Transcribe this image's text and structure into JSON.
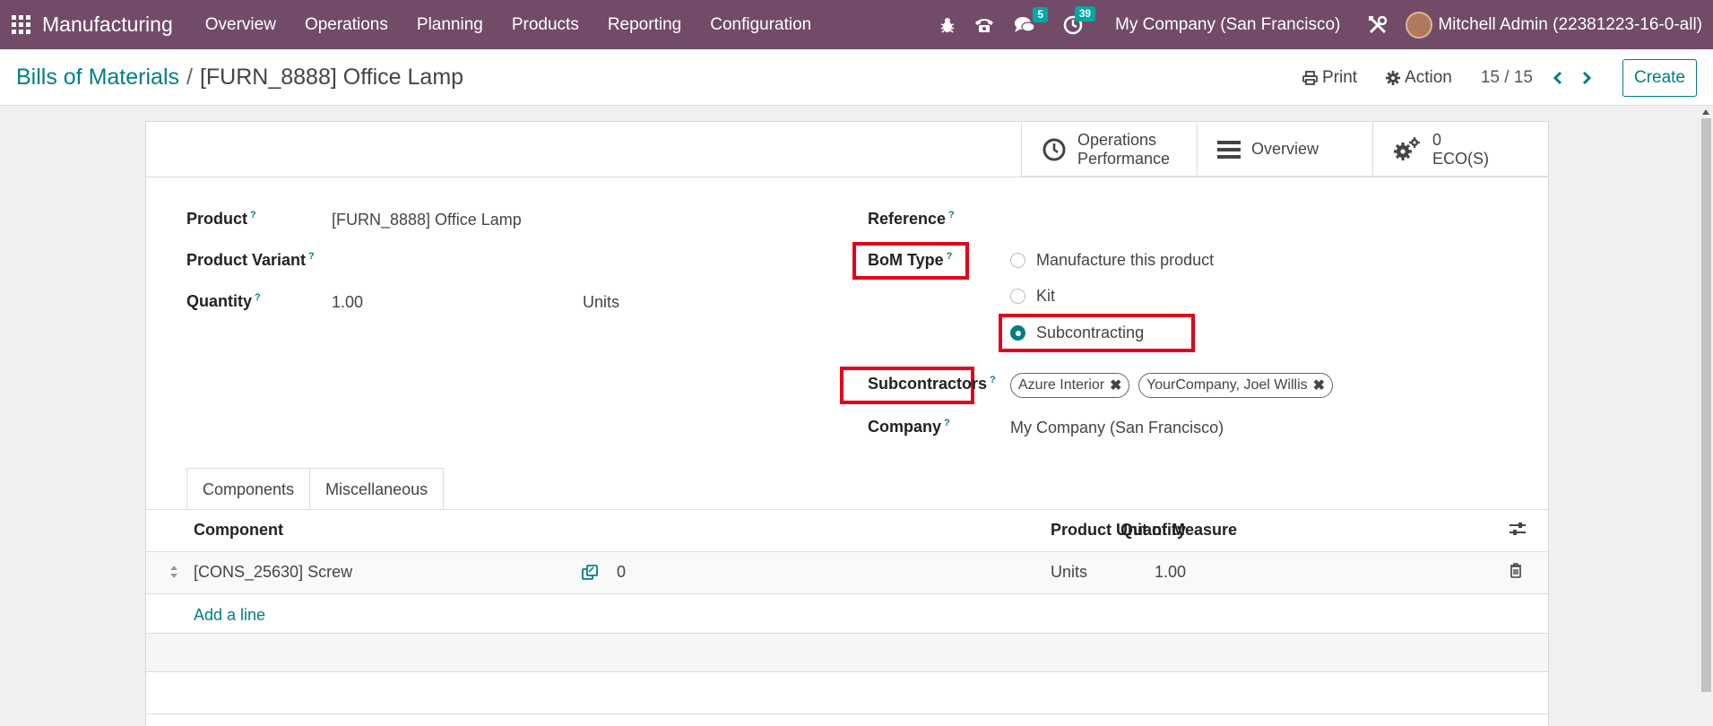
{
  "navbar": {
    "brand": "Manufacturing",
    "menu": [
      "Overview",
      "Operations",
      "Planning",
      "Products",
      "Reporting",
      "Configuration"
    ],
    "messages_count": "5",
    "activities_count": "39",
    "company": "My Company (San Francisco)",
    "user": "Mitchell Admin (22381223-16-0-all)"
  },
  "control_panel": {
    "breadcrumb_parent": "Bills of Materials",
    "breadcrumb_separator": "/",
    "breadcrumb_current": "[FURN_8888] Office Lamp",
    "print_label": "Print",
    "action_label": "Action",
    "pager": "15 / 15",
    "create_label": "Create"
  },
  "smart_buttons": {
    "operations_line1": "Operations",
    "operations_line2": "Performance",
    "overview": "Overview",
    "eco_count": "0",
    "eco_label": "ECO(S)"
  },
  "form": {
    "product_label": "Product",
    "product_value": "[FURN_8888] Office Lamp",
    "variant_label": "Product Variant",
    "quantity_label": "Quantity",
    "quantity_value": "1.00",
    "quantity_uom": "Units",
    "reference_label": "Reference",
    "bom_type_label": "BoM Type",
    "bom_type_options": [
      "Manufacture this product",
      "Kit",
      "Subcontracting"
    ],
    "bom_type_selected": "Subcontracting",
    "subcontractors_label": "Subcontractors",
    "subcontractors": [
      "Azure Interior",
      "YourCompany, Joel Willis"
    ],
    "company_label": "Company",
    "company_value": "My Company (San Francisco)",
    "help_mark": "?"
  },
  "tabs": [
    "Components",
    "Miscellaneous"
  ],
  "components_table": {
    "headers": {
      "component": "Component",
      "quantity": "Quantity",
      "uom": "Product Unit of Measure"
    },
    "rows": [
      {
        "component": "[CONS_25630] Screw",
        "forecast": "0",
        "quantity": "1.00",
        "uom": "Units"
      }
    ],
    "add_line": "Add a line"
  },
  "colors": {
    "navbar": "#714b67",
    "accent": "#017e84",
    "badge": "#01a7a6",
    "highlight": "#e3001a"
  }
}
